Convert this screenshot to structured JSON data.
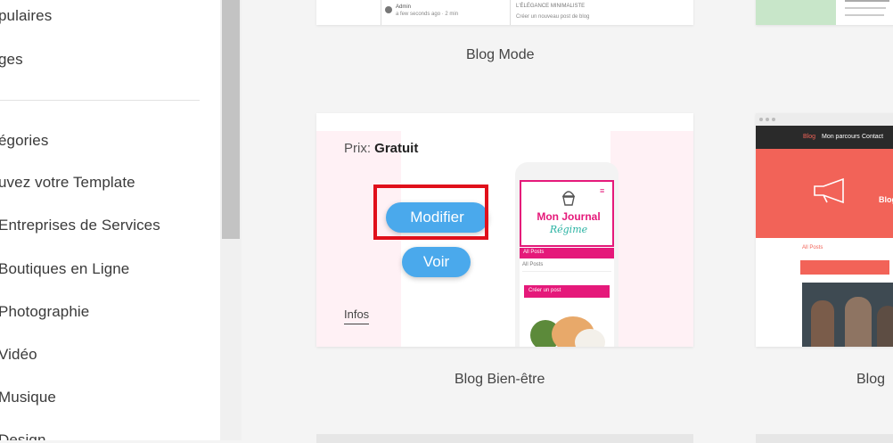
{
  "sidebar": {
    "items": [
      {
        "label": "pulaires"
      },
      {
        "label": "ges"
      },
      {
        "label": "égories"
      },
      {
        "label": "uvez votre Template"
      },
      {
        "label": "Entreprises de Services"
      },
      {
        "label": "Boutiques en Ligne"
      },
      {
        "label": "Photographie"
      },
      {
        "label": "Vidéo"
      },
      {
        "label": "Musique"
      },
      {
        "label": "Design"
      }
    ]
  },
  "top_cards": [
    {
      "title": "Blog Mode"
    }
  ],
  "top_card_snippets": {
    "admin_name": "Admin",
    "admin_time": "a few seconds ago · 2 min",
    "elegance": "L'ÉLÉGANCE MINIMALISTE",
    "create_post": "Créer un nouveau post de blog"
  },
  "main_card": {
    "price_label": "Prix:",
    "price_value": "Gratuit",
    "edit_button": "Modifier",
    "view_button": "Voir",
    "info_link": "Infos",
    "title": "Blog Bien-être",
    "preview": {
      "journal_title": "Mon Journal",
      "journal_subtitle": "Régime",
      "bar_label": "All Posts",
      "posts_label": "All Posts",
      "create_label": "Créer un post"
    }
  },
  "right_card": {
    "title": "Blog",
    "nav": [
      "Blog",
      "Mon parcours",
      "Contact"
    ],
    "hero_text": "Blog",
    "posts_label": "All Posts"
  },
  "colors": {
    "accent_blue": "#4aa9ec",
    "highlight_red": "#e0101b",
    "magenta": "#e5197a",
    "coral": "#f26358"
  }
}
